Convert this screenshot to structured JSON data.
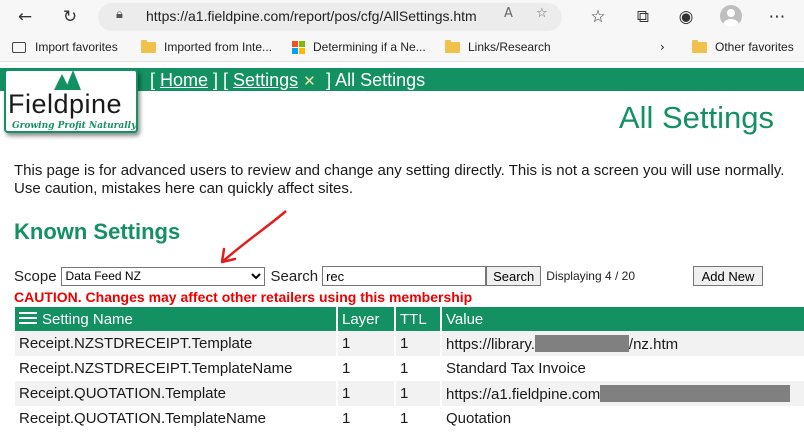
{
  "browser": {
    "url": "https://a1.fieldpine.com/report/pos/cfg/AllSettings.htm",
    "favorites": [
      {
        "label": "Import favorites",
        "icon": "import-icon"
      },
      {
        "label": "Imported from Inte...",
        "icon": "folder-icon"
      },
      {
        "label": "Determining if a Ne...",
        "icon": "microsoft-logo-icon"
      },
      {
        "label": "Links/Research",
        "icon": "folder-icon"
      },
      {
        "label": "Other favorites",
        "icon": "folder-icon"
      }
    ]
  },
  "header": {
    "bracket_open_home": "[ ",
    "home_link": "Home",
    "sep": " ] [ ",
    "settings_link": "Settings",
    "crumb_current": " ] All Settings",
    "logo_text": "Fieldpine",
    "logo_tagline": "Growing Profit Naturally"
  },
  "page": {
    "title": "All Settings",
    "intro": "This page is for advanced users to review and change any setting directly. This is not a screen you will use normally. Use caution, mistakes here can quickly affect sites.",
    "section_title": "Known Settings"
  },
  "filters": {
    "scope_label": "Scope",
    "scope_value": "Data Feed NZ",
    "search_label": "Search",
    "search_value": "rec",
    "search_button": "Search",
    "displaying": "Displaying 4 / 20",
    "add_new": "Add New"
  },
  "caution": "CAUTION. Changes may affect other retailers using this membership",
  "table": {
    "headers": [
      "Setting Name",
      "Layer",
      "TTL",
      "Value"
    ],
    "rows": [
      {
        "name": "Receipt.NZSTDRECEIPT.Template",
        "layer": "1",
        "ttl": "1",
        "value_a": "https://library.",
        "value_b": "/nz.htm"
      },
      {
        "name": "Receipt.NZSTDRECEIPT.TemplateName",
        "layer": "1",
        "ttl": "1",
        "value_a": "Standard Tax Invoice",
        "value_b": ""
      },
      {
        "name": "Receipt.QUOTATION.Template",
        "layer": "1",
        "ttl": "1",
        "value_a": "https://a1.fieldpine.com",
        "value_b": ""
      },
      {
        "name": "Receipt.QUOTATION.TemplateName",
        "layer": "1",
        "ttl": "1",
        "value_a": "Quotation",
        "value_b": ""
      }
    ]
  },
  "colors": {
    "brand_green": "#139162",
    "caution_red": "#ee0000",
    "annotation_arrow": "#e02020"
  }
}
